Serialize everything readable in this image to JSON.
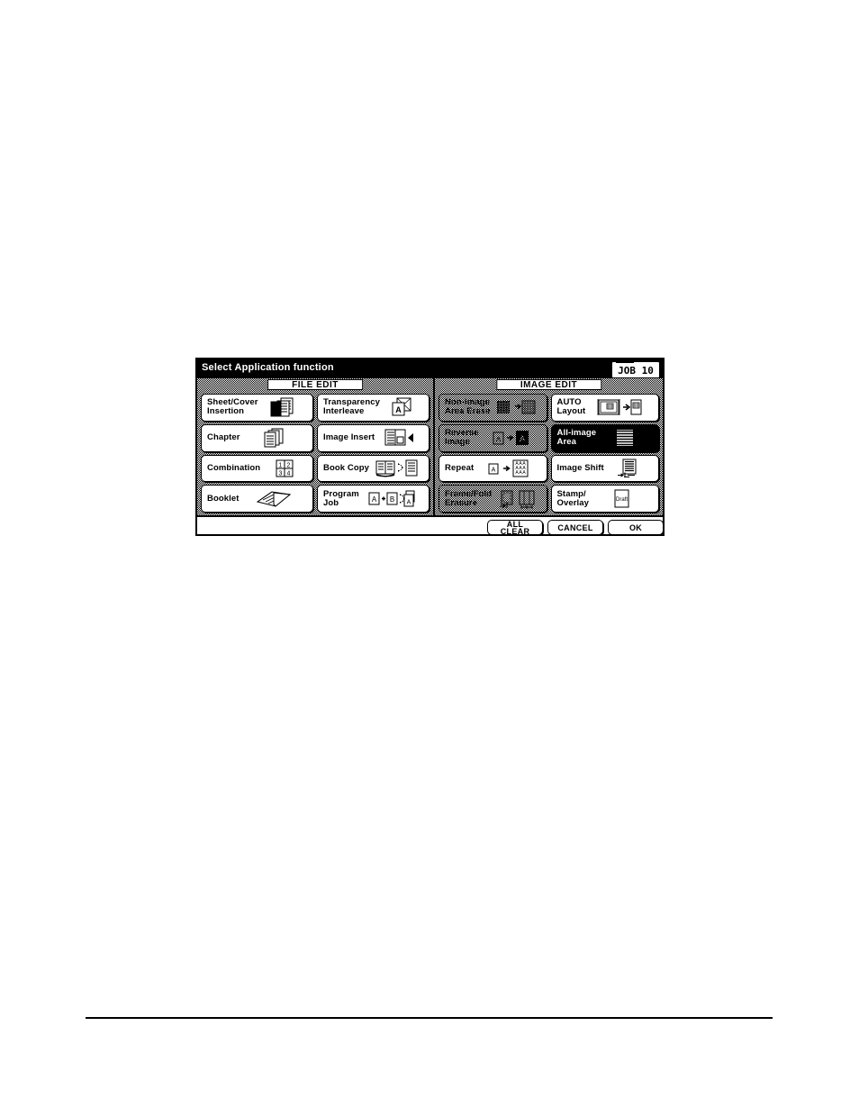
{
  "panel": {
    "title": "Select Application function",
    "job_badge": "JOB 10"
  },
  "sections": [
    {
      "id": "file-edit",
      "header": "FILE EDIT",
      "buttons": [
        {
          "id": "sheet-cover-insertion",
          "label": "Sheet/Cover\nInsertion",
          "icon": "stacked-sheets-icon",
          "state": "normal"
        },
        {
          "id": "transparency-interleave",
          "label": "Transparency\nInterleave",
          "icon": "transparency-sheet-icon",
          "state": "normal"
        },
        {
          "id": "chapter",
          "label": "Chapter",
          "icon": "chapter-pages-icon",
          "state": "normal"
        },
        {
          "id": "image-insert",
          "label": "Image Insert",
          "icon": "image-insert-icon",
          "state": "normal"
        },
        {
          "id": "combination",
          "label": "Combination",
          "icon": "combination-grid-icon",
          "state": "normal"
        },
        {
          "id": "book-copy",
          "label": "Book Copy",
          "icon": "book-copy-icon",
          "state": "normal"
        },
        {
          "id": "booklet",
          "label": "Booklet",
          "icon": "booklet-icon",
          "state": "normal"
        },
        {
          "id": "program-job",
          "label": "Program\nJob",
          "icon": "program-job-icon",
          "state": "normal"
        }
      ]
    },
    {
      "id": "image-edit",
      "header": "IMAGE EDIT",
      "buttons": [
        {
          "id": "non-image-area-erase",
          "label": "Non-image\nArea Erase",
          "icon": "area-erase-icon",
          "state": "disabled"
        },
        {
          "id": "auto-layout",
          "label": "AUTO\nLayout",
          "icon": "auto-layout-icon",
          "state": "normal"
        },
        {
          "id": "reverse-image",
          "label": "Reverse\nImage",
          "icon": "reverse-image-icon",
          "state": "disabled"
        },
        {
          "id": "all-image-area",
          "label": "All-image\nArea",
          "icon": "all-image-area-icon",
          "state": "selected"
        },
        {
          "id": "repeat",
          "label": "Repeat",
          "icon": "repeat-icon",
          "state": "normal"
        },
        {
          "id": "image-shift",
          "label": "Image Shift",
          "icon": "image-shift-icon",
          "state": "normal"
        },
        {
          "id": "frame-fold-erasure",
          "label": "Frame/Fold\nErasure",
          "icon": "frame-fold-erasure-icon",
          "state": "disabled"
        },
        {
          "id": "stamp-overlay",
          "label": "Stamp/\nOverlay",
          "icon": "stamp-overlay-icon",
          "state": "normal"
        }
      ]
    }
  ],
  "icon_text": {
    "transparency_letter": "A",
    "reverse_from": "A",
    "reverse_to": "A",
    "repeat_from": "A",
    "combination_cells": [
      "1",
      "2",
      "3",
      "4"
    ],
    "program_job_a": "A",
    "program_job_b": "B",
    "program_job_out": "A",
    "stamp_text": "Draft"
  },
  "footer": {
    "all_clear": "ALL\nCLEAR",
    "cancel": "CANCEL",
    "ok": "OK"
  },
  "colors": {
    "panel_border": "#000000",
    "titlebar_bg": "#000000",
    "titlebar_fg": "#ffffff",
    "button_bg": "#ffffff",
    "selected_bg": "#000000",
    "selected_fg": "#ffffff",
    "page_bg": "#ffffff"
  }
}
